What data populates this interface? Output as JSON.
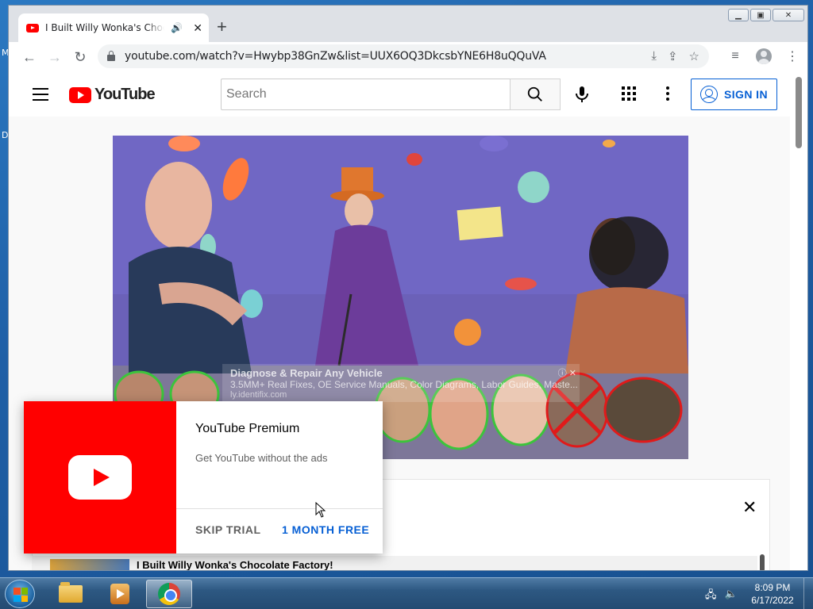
{
  "browser": {
    "tab_title": "I Built Willy Wonka's Chocolate Factory!",
    "new_tab": "+",
    "url": "youtube.com/watch?v=Hwybp38GnZw&list=UUX6OQ3DkcsbYNE6H8uQQuVA"
  },
  "youtube": {
    "logo_text": "YouTube",
    "search_placeholder": "Search",
    "signin_label": "SIGN IN"
  },
  "video_ad": {
    "title": "Diagnose & Repair Any Vehicle",
    "description": "3.5MM+ Real Fixes, OE Service Manuals, Color Diagrams, Labor Guides, Maste...",
    "url": "ly.identifix.com"
  },
  "promo": {
    "title": "YouTube Premium",
    "subtitle": "Get YouTube without the ads",
    "skip_label": "SKIP TRIAL",
    "free_label": "1 MONTH FREE"
  },
  "playlist": {
    "item_title": "I Built Willy Wonka's Chocolate Factory!"
  },
  "desktop": {
    "left_glyph_1": "M",
    "left_glyph_2": "D"
  },
  "taskbar": {
    "time": "8:09 PM",
    "date": "6/17/2022"
  },
  "colors": {
    "brand_red": "#ff0000",
    "link_blue": "#065fd4"
  }
}
